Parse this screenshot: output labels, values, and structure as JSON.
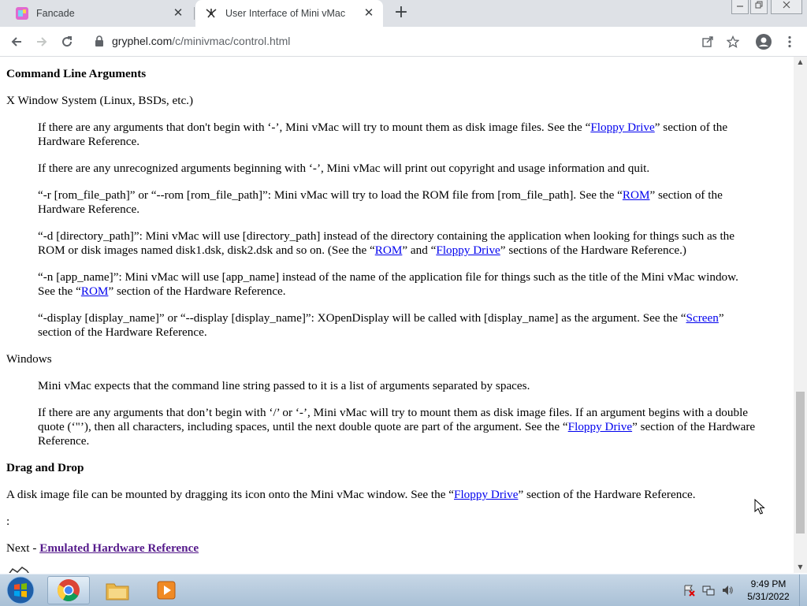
{
  "browser": {
    "tabs": [
      {
        "title": "Fancade",
        "active": false
      },
      {
        "title": "User Interface of Mini vMac",
        "active": true
      }
    ],
    "url_host": "gryphel.com",
    "url_path": "/c/minivmac/control.html"
  },
  "page": {
    "heading1": "Command Line Arguments",
    "xwin_label": "X Window System (Linux, BSDs, etc.)",
    "x1": {
      "a": "If there are any arguments that don't begin with ‘-’, Mini vMac will try to mount them as disk image files. See the “",
      "link": "Floppy Drive",
      "b": "” section of the Hardware Reference."
    },
    "x2": "If there are any unrecognized arguments beginning with ‘-’, Mini vMac will print out copyright and usage information and quit.",
    "x3": {
      "a": "“-r [rom_file_path]” or “--rom [rom_file_path]”: Mini vMac will try to load the ROM file from [rom_file_path]. See the “",
      "link": "ROM",
      "b": "” section of the Hardware Reference."
    },
    "x4": {
      "a": "“-d [directory_path]”: Mini vMac will use [directory_path] instead of the directory containing the application when looking for things such as the ROM or disk images named disk1.dsk, disk2.dsk and so on. (See the “",
      "link1": "ROM",
      "b": "” and “",
      "link2": "Floppy Drive",
      "c": "” sections of the Hardware Reference.)"
    },
    "x5": {
      "a": "“-n [app_name]”: Mini vMac will use [app_name] instead of the name of the application file for things such as the title of the Mini vMac window. See the “",
      "link": "ROM",
      "b": "” section of the Hardware Reference."
    },
    "x6": {
      "a": "“-display [display_name]” or “--display [display_name]”: XOpenDisplay will be called with [display_name] as the argument. See the “",
      "link": "Screen",
      "b": "” section of the Hardware Reference."
    },
    "windows_label": "Windows",
    "w1": "Mini vMac expects that the command line string passed to it is a list of arguments separated by spaces.",
    "w2": {
      "a": "If there are any arguments that don’t begin with ‘/’ or ‘-’, Mini vMac will try to mount them as disk image files. If an argument begins with a double quote (‘\"’), then all characters, including spaces, until the next double quote are part of the argument. See the “",
      "link": "Floppy Drive",
      "b": "” section of the Hardware Reference."
    },
    "heading2": "Drag and Drop",
    "dd": {
      "a": "A disk image file can be mounted by dragging its icon onto the Mini vMac window. See the “",
      "link": "Floppy Drive",
      "b": "” section of the Hardware Reference."
    },
    "colon": ":",
    "next_prefix": "Next - ",
    "next_link": "Emulated Hardware Reference"
  },
  "taskbar": {
    "time": "9:49 PM",
    "date": "5/31/2022"
  },
  "colors": {
    "link": "#0000ee",
    "visited_link": "#551a8b",
    "tabstrip": "#dee1e6"
  }
}
